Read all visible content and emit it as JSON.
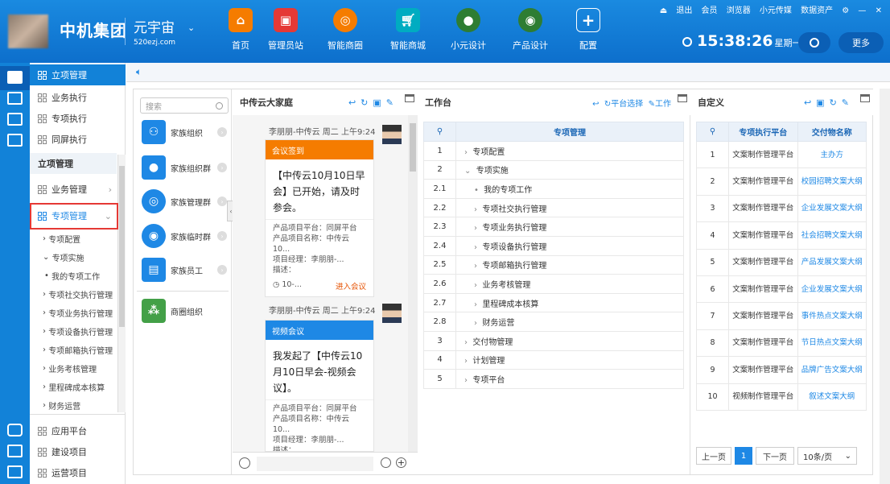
{
  "header": {
    "brand": "中机集团",
    "metaverse": "元宇宙",
    "url": "520ezj.com",
    "nav": [
      {
        "label": "首页",
        "icon": "home-icon",
        "color": "#f57c00"
      },
      {
        "label": "管理员站",
        "icon": "monitor-icon",
        "color": "#e53935"
      },
      {
        "label": "智能商圈",
        "icon": "ring-icon",
        "color": "#f57c00"
      },
      {
        "label": "智能商城",
        "icon": "cart-icon",
        "color": "#00acc1"
      },
      {
        "label": "小元设计",
        "icon": "globe-icon",
        "color": "#2e7d32"
      },
      {
        "label": "产品设计",
        "icon": "people-icon",
        "color": "#2e7d32"
      },
      {
        "label": "配置",
        "icon": "plus-icon",
        "color": "#1a7bd6"
      }
    ],
    "links": [
      "退出",
      "会员",
      "浏览器",
      "小元传媒",
      "数据资产"
    ],
    "time": "15:38:26",
    "weekday": "星期一",
    "more": "更多"
  },
  "sidebar": {
    "top": [
      {
        "label": "立项管理"
      },
      {
        "label": "业务执行"
      },
      {
        "label": "专项执行"
      },
      {
        "label": "同屏执行"
      }
    ],
    "section_title": "立项管理",
    "items": [
      {
        "label": "业务管理"
      },
      {
        "label": "专项管理"
      }
    ],
    "subitems": [
      "专项配置",
      "专项实施",
      "我的专项工作",
      "专项社交执行管理",
      "专项业务执行管理",
      "专项设备执行管理",
      "专项邮箱执行管理",
      "业务考核管理",
      "里程碑成本核算",
      "财务运营"
    ],
    "bottom": [
      {
        "label": "应用平台"
      },
      {
        "label": "建设项目"
      },
      {
        "label": "运营项目"
      }
    ]
  },
  "groups": {
    "search_placeholder": "搜索",
    "items": [
      "家族组织",
      "家族组织群",
      "家族管理群",
      "家族临时群",
      "家族员工",
      "商圈组织"
    ]
  },
  "chat": {
    "title": "中传云大家庭",
    "messages": [
      {
        "sender": "李朋朋-中传云",
        "time": "周二 上午9:24",
        "type": "会议签到",
        "body": "【中传云10月10日早会】已开始，请及时参会。",
        "meta": [
          "产品项目平台：同屏平台",
          "产品项目名称：中传云10...",
          "项目经理：李朋朋-...",
          "描述："
        ],
        "footer_time": "10-...",
        "action": "进入会议"
      },
      {
        "sender": "李朋朋-中传云",
        "time": "周二 上午9:24",
        "type": "视频会议",
        "body": "我发起了【中传云10月10日早会-视频会议】。",
        "meta": [
          "产品项目平台：同屏平台",
          "产品项目名称：中传云10...",
          "项目经理：李朋朋-...",
          "描述："
        ]
      }
    ]
  },
  "workbench": {
    "title": "工作台",
    "tool_platform": "平台选择",
    "tool_work": "工作",
    "column": "专项管理",
    "rows": [
      {
        "n": "1",
        "label": "专项配置",
        "mark": "›"
      },
      {
        "n": "2",
        "label": "专项实施",
        "mark": "⌄"
      },
      {
        "n": "2.1",
        "label": "我的专项工作",
        "mark": "•"
      },
      {
        "n": "2.2",
        "label": "专项社交执行管理",
        "mark": "›"
      },
      {
        "n": "2.3",
        "label": "专项业务执行管理",
        "mark": "›"
      },
      {
        "n": "2.4",
        "label": "专项设备执行管理",
        "mark": "›"
      },
      {
        "n": "2.5",
        "label": "专项邮箱执行管理",
        "mark": "›"
      },
      {
        "n": "2.6",
        "label": "业务考核管理",
        "mark": "›"
      },
      {
        "n": "2.7",
        "label": "里程碑成本核算",
        "mark": "›"
      },
      {
        "n": "2.8",
        "label": "财务运营",
        "mark": "›"
      },
      {
        "n": "3",
        "label": "交付物管理",
        "mark": "›"
      },
      {
        "n": "4",
        "label": "计划管理",
        "mark": "›"
      },
      {
        "n": "5",
        "label": "专项平台",
        "mark": "›"
      }
    ]
  },
  "custom": {
    "title": "自定义",
    "col1": "专项执行平台",
    "col2": "交付物名称",
    "rows": [
      {
        "n": "1",
        "platform": "文案制作管理平台",
        "name": "主办方"
      },
      {
        "n": "2",
        "platform": "文案制作管理平台",
        "name": "校园招聘文案大纲"
      },
      {
        "n": "3",
        "platform": "文案制作管理平台",
        "name": "企业发展文案大纲"
      },
      {
        "n": "4",
        "platform": "文案制作管理平台",
        "name": "社会招聘文案大纲"
      },
      {
        "n": "5",
        "platform": "文案制作管理平台",
        "name": "产品发展文案大纲"
      },
      {
        "n": "6",
        "platform": "文案制作管理平台",
        "name": "企业发展文案大纲"
      },
      {
        "n": "7",
        "platform": "文案制作管理平台",
        "name": "事件热点文案大纲"
      },
      {
        "n": "8",
        "platform": "文案制作管理平台",
        "name": "节日热点文案大纲"
      },
      {
        "n": "9",
        "platform": "文案制作管理平台",
        "name": "品牌广告文案大纲"
      },
      {
        "n": "10",
        "platform": "视频制作管理平台",
        "name": "叙述文案大纲"
      }
    ],
    "pager": {
      "prev": "上一页",
      "page": "1",
      "next": "下一页",
      "size": "10条/页"
    }
  },
  "colors": {
    "accent": "#1e88e5",
    "card_orange": "#f57c00",
    "card_blue": "#1e88e5",
    "highlight": "#e53935"
  }
}
